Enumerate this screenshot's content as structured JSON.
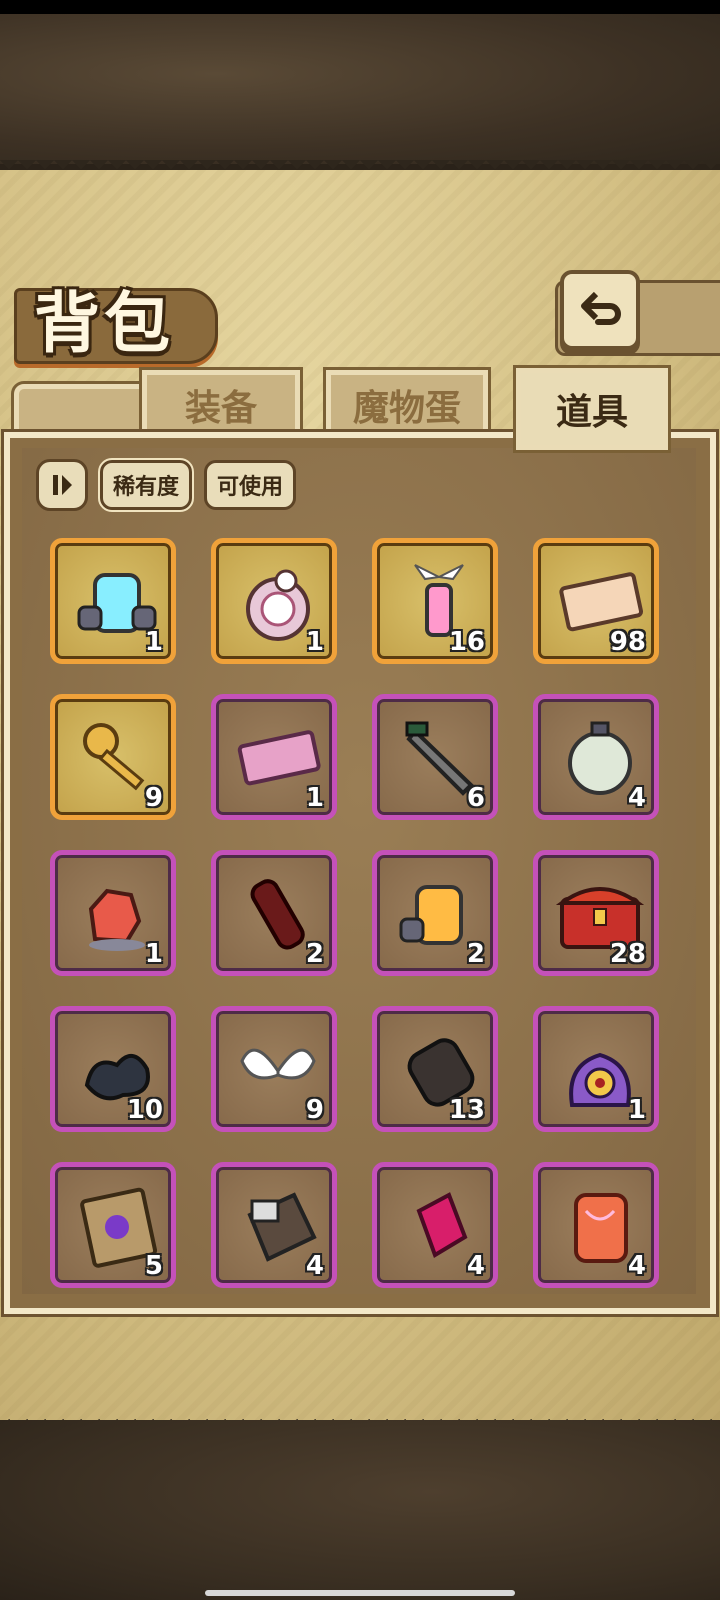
{
  "header": {
    "title": "背包"
  },
  "tabs": [
    {
      "label": "装备",
      "active": false
    },
    {
      "label": "魔物蛋",
      "active": false
    },
    {
      "label": "道具",
      "active": true
    }
  ],
  "filters": [
    {
      "label": "稀有度",
      "selected": true
    },
    {
      "label": "可使用",
      "selected": false
    }
  ],
  "items": [
    {
      "icon": "portal-gate-icon",
      "qty": "1",
      "rarity": "gold"
    },
    {
      "icon": "cat-pocket-watch-icon",
      "qty": "1",
      "rarity": "gold"
    },
    {
      "icon": "winged-lantern-icon",
      "qty": "16",
      "rarity": "gold"
    },
    {
      "icon": "golden-ticket-icon",
      "qty": "98",
      "rarity": "gold"
    },
    {
      "icon": "golden-key-icon",
      "qty": "9",
      "rarity": "gold"
    },
    {
      "icon": "pink-ticket-icon",
      "qty": "1",
      "rarity": "purple"
    },
    {
      "icon": "dark-sword-icon",
      "qty": "6",
      "rarity": "purple"
    },
    {
      "icon": "glass-lantern-icon",
      "qty": "4",
      "rarity": "purple"
    },
    {
      "icon": "red-ore-icon",
      "qty": "1",
      "rarity": "purple"
    },
    {
      "icon": "cola-bottle-icon",
      "qty": "2",
      "rarity": "purple"
    },
    {
      "icon": "yellow-portal-icon",
      "qty": "2",
      "rarity": "purple"
    },
    {
      "icon": "treasure-chest-icon",
      "qty": "28",
      "rarity": "purple"
    },
    {
      "icon": "dark-smoke-icon",
      "qty": "10",
      "rarity": "purple"
    },
    {
      "icon": "angel-wings-icon",
      "qty": "9",
      "rarity": "purple"
    },
    {
      "icon": "scroll-cylinder-icon",
      "qty": "13",
      "rarity": "purple"
    },
    {
      "icon": "eye-monster-icon",
      "qty": "1",
      "rarity": "purple"
    },
    {
      "icon": "magic-book-icon",
      "qty": "5",
      "rarity": "purple"
    },
    {
      "icon": "ship-hull-icon",
      "qty": "4",
      "rarity": "purple"
    },
    {
      "icon": "pink-crystal-icon",
      "qty": "4",
      "rarity": "purple"
    },
    {
      "icon": "fire-crystal-icon",
      "qty": "4",
      "rarity": "purple"
    }
  ],
  "colors": {
    "gold_border": "#f0a23a",
    "purple_border": "#c451b9",
    "parchment": "#d4c085"
  }
}
